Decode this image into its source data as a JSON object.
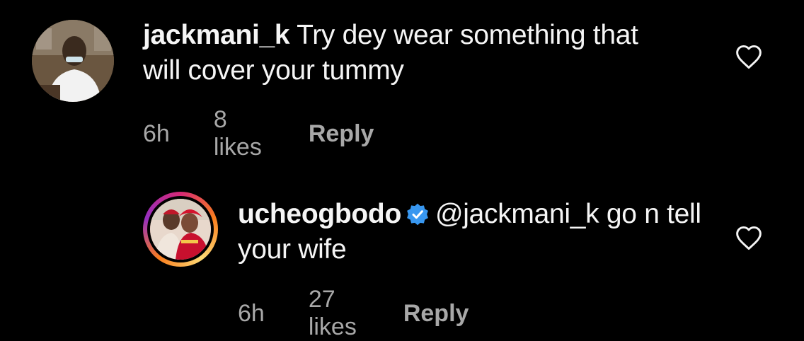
{
  "comments": [
    {
      "username": "jackmani_k",
      "text": "Try dey wear something that will cover your tummy",
      "time": "6h",
      "likes": "8 likes",
      "reply_label": "Reply",
      "avatar_icon": "user-avatar-man-icon"
    },
    {
      "username": "ucheogbodo",
      "verified": true,
      "mention": "@jackmani_k",
      "text": "go n tell your wife",
      "time": "6h",
      "likes": "27 likes",
      "reply_label": "Reply",
      "avatar_icon": "user-avatar-couple-icon"
    }
  ],
  "colors": {
    "background": "#000000",
    "text": "#f5f5f5",
    "meta": "#a8a8a8",
    "verified": "#3897f0"
  }
}
